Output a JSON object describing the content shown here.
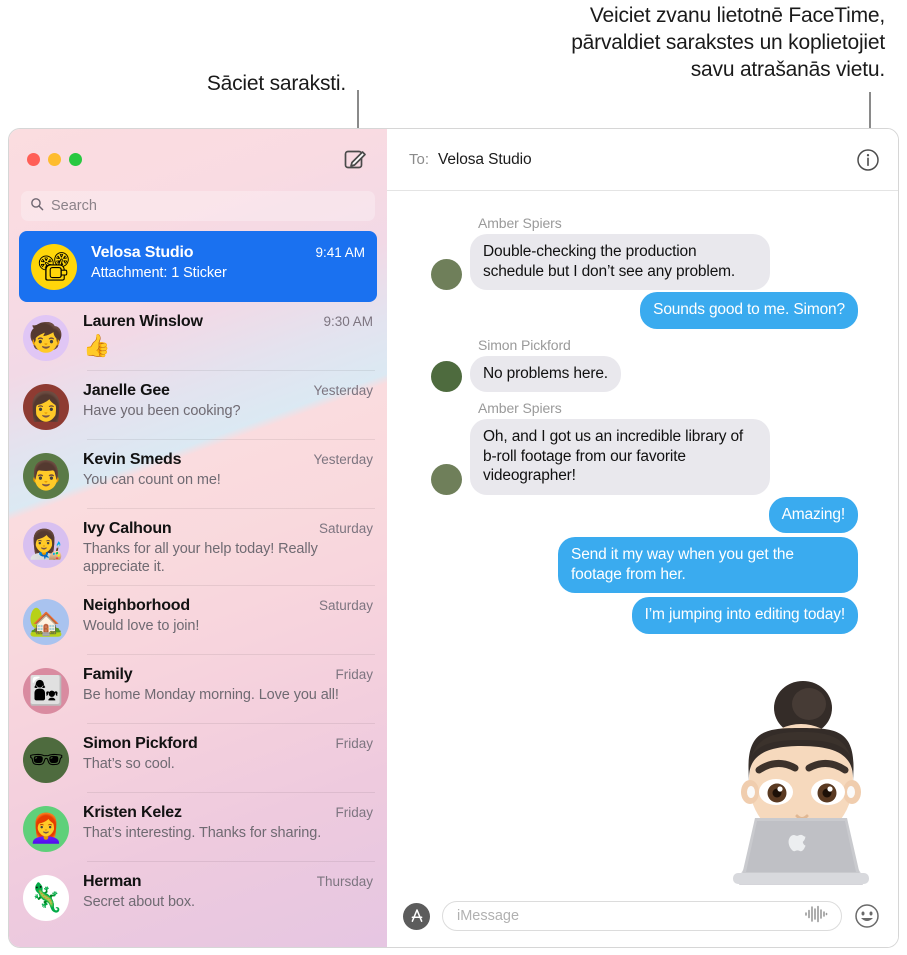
{
  "callouts": {
    "left": "Sāciet saraksti.",
    "right": "Veiciet zvanu lietotnē FaceTime,\npārvaldiet sarakstes un koplietojiet\nsavu atrašanās vietu."
  },
  "sidebar": {
    "search": {
      "placeholder": "Search",
      "icon": "search-icon"
    },
    "compose_icon": "compose-icon",
    "conversations": [
      {
        "name": "Velosa Studio",
        "preview": "Attachment: 1 Sticker",
        "time": "9:41 AM",
        "avatar_emoji": "📽",
        "avatar_bg": "#ffd60a",
        "selected": true,
        "is_emoji_preview": false
      },
      {
        "name": "Lauren Winslow",
        "preview": "👍",
        "time": "9:30 AM",
        "avatar_emoji": "🧒",
        "avatar_bg": "#e0c6f5",
        "selected": false,
        "is_emoji_preview": true
      },
      {
        "name": "Janelle Gee",
        "preview": "Have you been cooking?",
        "time": "Yesterday",
        "avatar_emoji": "👩",
        "avatar_bg": "#8e3b32",
        "selected": false,
        "is_emoji_preview": false
      },
      {
        "name": "Kevin Smeds",
        "preview": "You can count on me!",
        "time": "Yesterday",
        "avatar_emoji": "👨",
        "avatar_bg": "#5a7a46",
        "selected": false,
        "is_emoji_preview": false
      },
      {
        "name": "Ivy Calhoun",
        "preview": "Thanks for all your help today! Really appreciate it.",
        "time": "Saturday",
        "avatar_emoji": "👩‍🎨",
        "avatar_bg": "#d8c0f0",
        "selected": false,
        "is_emoji_preview": false
      },
      {
        "name": "Neighborhood",
        "preview": "Would love to join!",
        "time": "Saturday",
        "avatar_emoji": "🏡",
        "avatar_bg": "#a9c3ef",
        "selected": false,
        "is_emoji_preview": false
      },
      {
        "name": "Family",
        "preview": "Be home Monday morning. Love you all!",
        "time": "Friday",
        "avatar_emoji": "👩‍👧",
        "avatar_bg": "#d98ba0",
        "selected": false,
        "is_emoji_preview": false
      },
      {
        "name": "Simon Pickford",
        "preview": "That’s so cool.",
        "time": "Friday",
        "avatar_emoji": "🕶",
        "avatar_bg": "#4e6b3e",
        "selected": false,
        "is_emoji_preview": false
      },
      {
        "name": "Kristen Kelez",
        "preview": "That’s interesting. Thanks for sharing.",
        "time": "Friday",
        "avatar_emoji": "👩‍🦰",
        "avatar_bg": "#5fd07a",
        "selected": false,
        "is_emoji_preview": false
      },
      {
        "name": "Herman",
        "preview": "Secret about box.",
        "time": "Thursday",
        "avatar_emoji": "🦎",
        "avatar_bg": "#ffffff",
        "selected": false,
        "is_emoji_preview": false
      }
    ]
  },
  "conversation": {
    "to_label": "To:",
    "to_value": "Velosa Studio",
    "info_icon": "info-circle-icon",
    "messages": [
      {
        "direction": "in",
        "sender": "Amber Spiers",
        "text": "Double-checking the production schedule but I don’t see any problem.",
        "avatar_bg": "#6f7f5a"
      },
      {
        "direction": "out",
        "sender": "",
        "text": "Sounds good to me. Simon?",
        "tail": true
      },
      {
        "direction": "in",
        "sender": "Simon Pickford",
        "text": "No problems here.",
        "avatar_bg": "#4e6b3e"
      },
      {
        "direction": "in",
        "sender": "Amber Spiers",
        "text": "Oh, and I got us an incredible library of b-roll footage from our favorite videographer!",
        "avatar_bg": "#6f7f5a"
      },
      {
        "direction": "out",
        "sender": "",
        "text": "Amazing!",
        "tail": false
      },
      {
        "direction": "out",
        "sender": "",
        "text": "Send it my way when you get the footage from her.",
        "tail": false
      },
      {
        "direction": "out",
        "sender": "",
        "text": "I’m jumping into editing today!",
        "tail": true
      }
    ],
    "sticker": "memoji-laptop-sticker"
  },
  "composer": {
    "apps_icon": "app-store-icon",
    "placeholder": "iMessage",
    "audio_icon": "audio-waveform-icon",
    "emoji_icon": "smiley-face-icon"
  },
  "colors": {
    "accent_blue": "#1a71f0",
    "bubble_out": "#3aabef",
    "bubble_in": "#e9e8ed"
  },
  "window_controls": {
    "close": "close-button",
    "minimize": "minimize-button",
    "zoom": "zoom-button"
  }
}
